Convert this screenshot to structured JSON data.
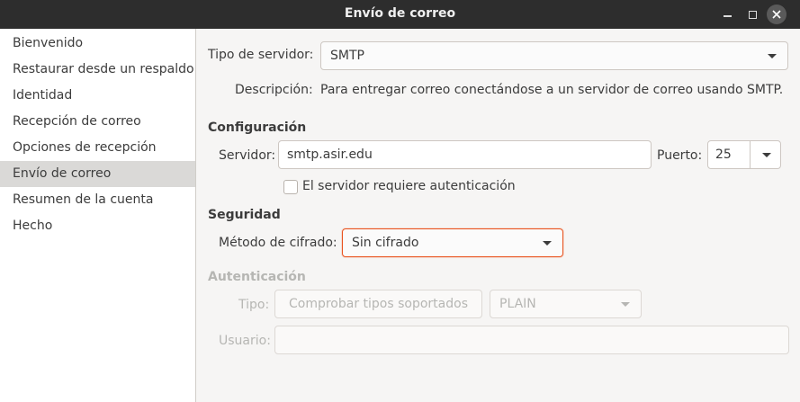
{
  "window": {
    "title": "Envío de correo"
  },
  "sidebar": {
    "items": [
      {
        "label": "Bienvenido"
      },
      {
        "label": "Restaurar desde un respaldo"
      },
      {
        "label": "Identidad"
      },
      {
        "label": "Recepción de correo"
      },
      {
        "label": "Opciones de recepción"
      },
      {
        "label": "Envío de correo"
      },
      {
        "label": "Resumen de la cuenta"
      },
      {
        "label": "Hecho"
      }
    ],
    "selected": "Envío de correo"
  },
  "server_type": {
    "label": "Tipo de servidor:",
    "value": "SMTP",
    "description_label": "Descripción:",
    "description": "Para entregar correo conectándose a un servidor de correo usando SMTP."
  },
  "configuration": {
    "heading": "Configuración",
    "server_label": "Servidor:",
    "server_value": "smtp.asir.edu",
    "port_label": "Puerto:",
    "port_value": "25",
    "auth_required_label": "El servidor requiere autenticación",
    "auth_required_checked": false
  },
  "security": {
    "heading": "Seguridad",
    "method_label": "Método de cifrado:",
    "method_value": "Sin cifrado"
  },
  "authentication": {
    "heading": "Autenticación",
    "type_label": "Tipo:",
    "check_button": "Comprobar tipos soportados",
    "type_value": "PLAIN",
    "user_label": "Usuario:",
    "user_value": ""
  },
  "colors": {
    "accent": "#e95420",
    "titlebar": "#2d2d2d",
    "selected_row": "#dad9d7"
  }
}
